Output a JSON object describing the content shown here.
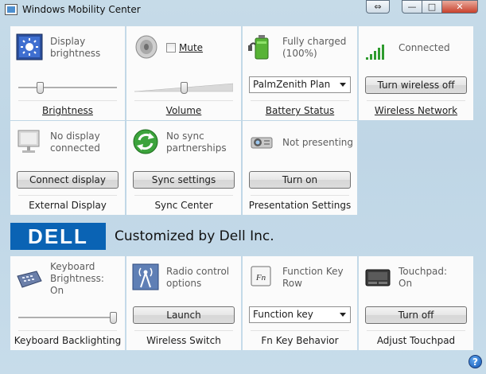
{
  "window": {
    "title": "Windows Mobility Center"
  },
  "titlebar_buttons": {
    "minimize": "—",
    "maximize": "□",
    "close": "✕",
    "rotate": "⇔"
  },
  "tiles": {
    "brightness": {
      "status_line1": "Display",
      "status_line2": "brightness",
      "title": "Brightness",
      "slider_level": 0.2,
      "icon": "display-brightness-icon"
    },
    "volume": {
      "mute_label": "Mute",
      "title": "Volume",
      "slider_level": 0.5,
      "muted": false,
      "icon": "speaker-icon"
    },
    "battery": {
      "status_line1": "Fully charged",
      "status_line2": "(100%)",
      "select_value": "PalmZenith Plan",
      "title": "Battery Status",
      "icon": "battery-icon"
    },
    "wireless": {
      "status": "Connected",
      "button": "Turn wireless off",
      "title": "Wireless Network",
      "icon": "signal-bars-icon"
    },
    "external_display": {
      "status_line1": "No display",
      "status_line2": "connected",
      "button": "Connect display",
      "title": "External Display",
      "icon": "monitor-icon"
    },
    "sync": {
      "status_line1": "No sync",
      "status_line2": "partnerships",
      "button": "Sync settings",
      "title": "Sync Center",
      "icon": "sync-icon"
    },
    "presentation": {
      "status": "Not presenting",
      "button": "Turn on",
      "title": "Presentation Settings",
      "icon": "projector-icon"
    },
    "keyboard": {
      "status_line1": "Keyboard",
      "status_line2": "Brightness:",
      "status_line3": "On",
      "title": "Keyboard Backlighting",
      "slider_level": 1.0,
      "icon": "keyboard-icon"
    },
    "radio": {
      "status_line1": "Radio control",
      "status_line2": "options",
      "button": "Launch",
      "title": "Wireless Switch",
      "icon": "radio-tower-icon"
    },
    "fn_key": {
      "status_line1": "Function Key",
      "status_line2": "Row",
      "select_value": "Function key",
      "title": "Fn Key Behavior",
      "icon_text": "Fn",
      "icon": "fn-key-icon"
    },
    "touchpad": {
      "status_line1": "Touchpad:",
      "status_line2": "On",
      "button": "Turn off",
      "title": "Adjust Touchpad",
      "icon": "touchpad-icon"
    }
  },
  "brand": {
    "logo_text": "DELL",
    "text": "Customized by Dell Inc."
  },
  "help": {
    "label": "?"
  },
  "colors": {
    "dell_blue": "#0a63b4",
    "signal_green": "#2e9b2e"
  }
}
